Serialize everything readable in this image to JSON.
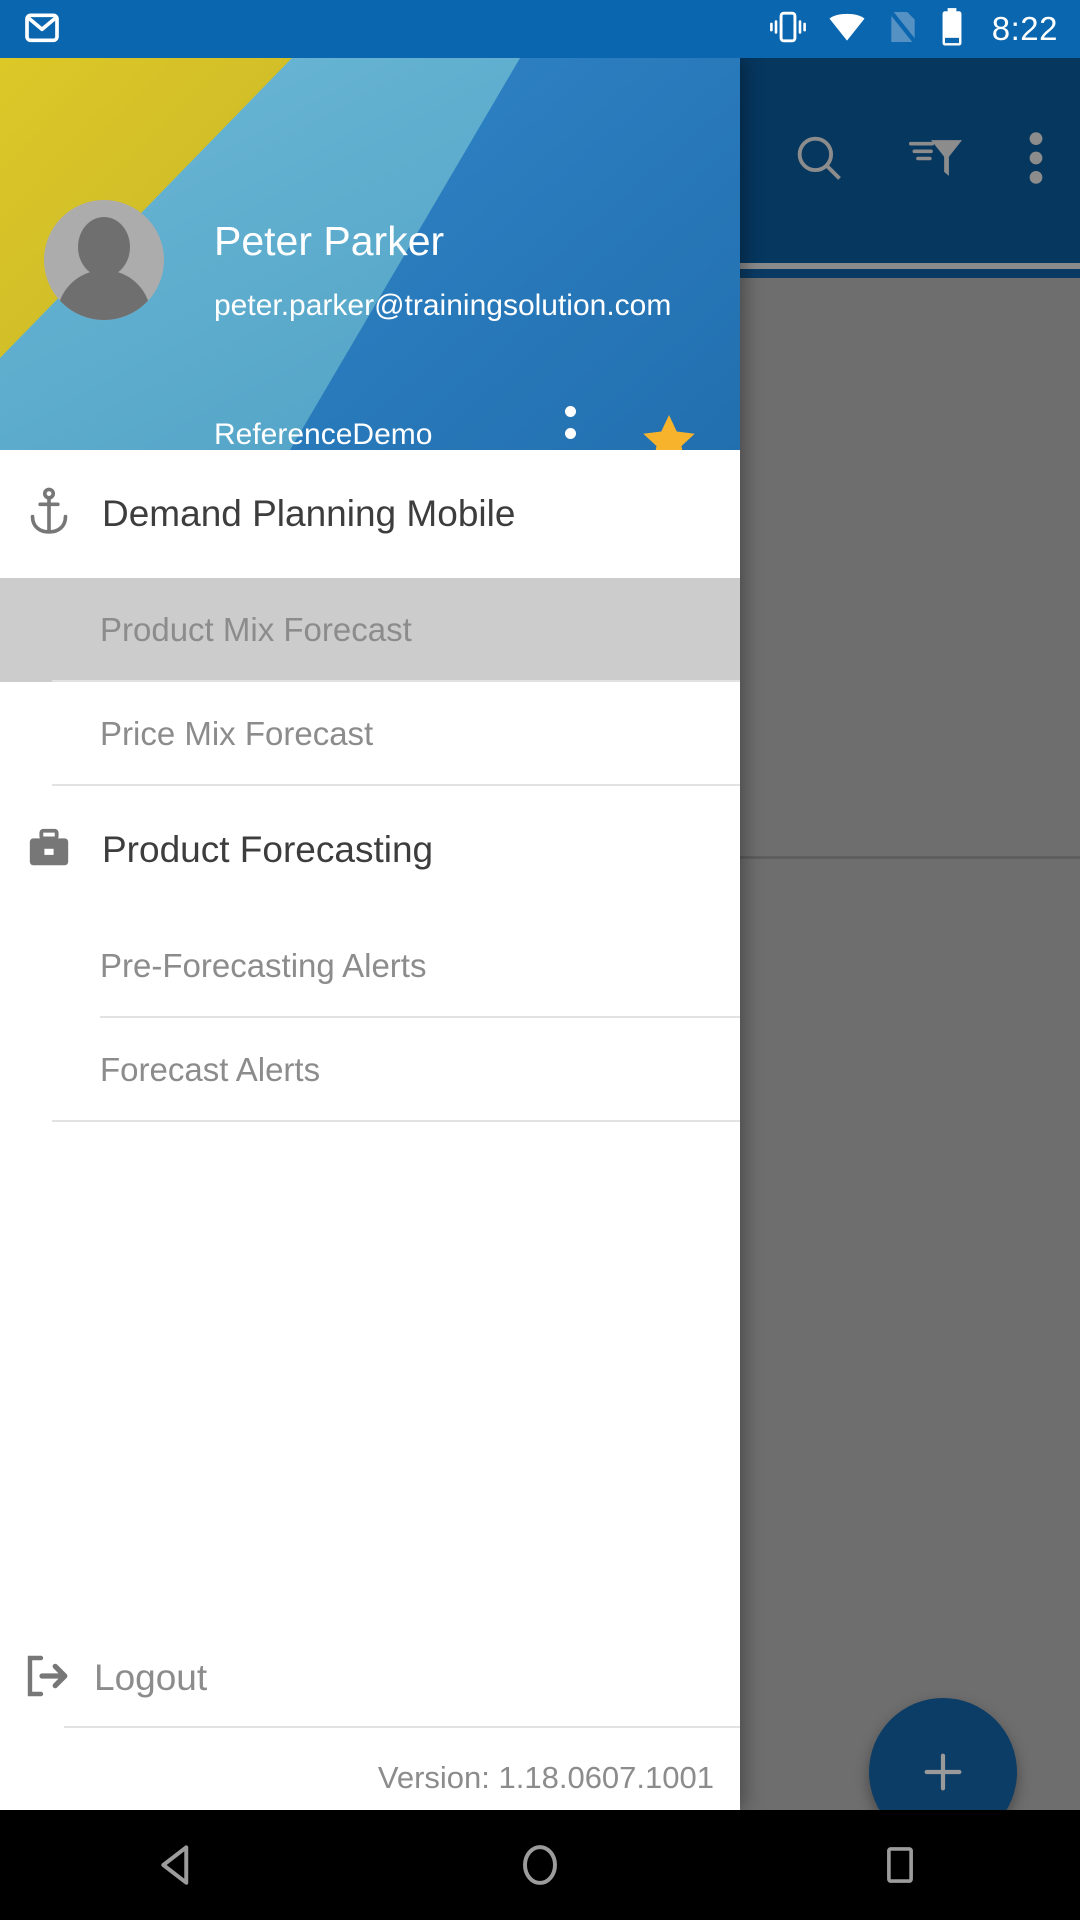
{
  "status_bar": {
    "time": "8:22",
    "background": "#0A66AE",
    "icons": [
      "gmail-icon",
      "vibrate-icon",
      "wifi-icon",
      "sim-card-off-icon",
      "battery-icon"
    ]
  },
  "app_bar": {
    "background": "#06375F",
    "actions": [
      {
        "name": "search-icon",
        "label": "Search"
      },
      {
        "name": "filter-icon",
        "label": "Filter"
      },
      {
        "name": "overflow-menu-icon",
        "label": "More options"
      }
    ]
  },
  "fab": {
    "label": "+",
    "name": "add-fab",
    "color": "#0C3D66"
  },
  "drawer": {
    "header": {
      "user_name": "Peter Parker",
      "user_email": "peter.parker@trainingsolution.com",
      "tenant": "ReferenceDemo",
      "avatar_name": "user-avatar",
      "overflow_label": "More",
      "favorite_label": "Favorite",
      "colors": {
        "yellow": "#D4C22B",
        "light_blue": "#5FAFD1",
        "blue": "#2D7CBE",
        "star": "#F7B32B"
      }
    },
    "groups": [
      {
        "icon": "anchor-icon",
        "title": "Demand Planning Mobile",
        "items": [
          {
            "label": "Product Mix Forecast",
            "selected": true
          },
          {
            "label": "Price Mix Forecast",
            "selected": false
          }
        ]
      },
      {
        "icon": "briefcase-icon",
        "title": "Product Forecasting",
        "items": [
          {
            "label": "Pre-Forecasting Alerts",
            "selected": false
          },
          {
            "label": "Forecast Alerts",
            "selected": false
          }
        ]
      }
    ],
    "footer": {
      "logout_label": "Logout",
      "logout_icon": "logout-icon",
      "version": "Version: 1.18.0607.1001"
    }
  },
  "navigation_bar": {
    "back_label": "Back",
    "home_label": "Home",
    "recents_label": "Recent apps"
  }
}
